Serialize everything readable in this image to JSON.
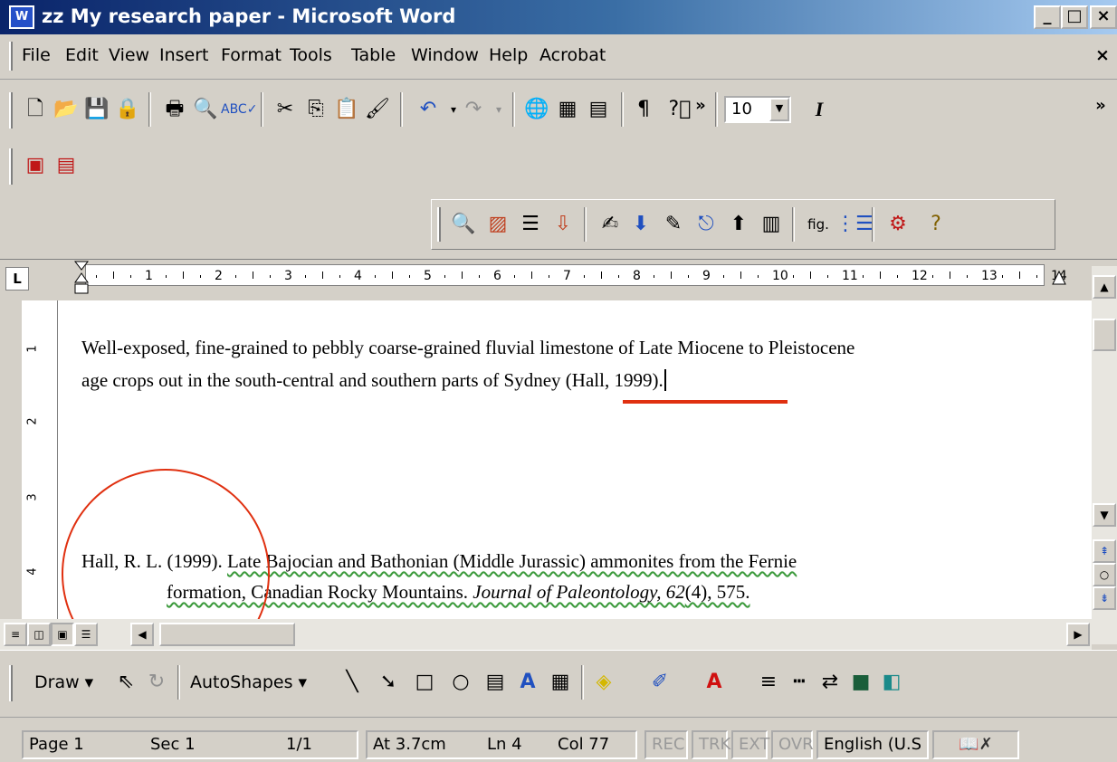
{
  "window": {
    "title": "zz My research paper - Microsoft Word",
    "app_icon": "W",
    "minimize_glyph": "_",
    "maximize_glyph": "□",
    "close_glyph": "×",
    "menu_close_glyph": "×"
  },
  "menu": [
    "File",
    "Edit",
    "View",
    "Insert",
    "Format",
    "Tools",
    "Table",
    "Window",
    "Help",
    "Acrobat"
  ],
  "standard_toolbar": {
    "icons": [
      "new-document-icon",
      "open-folder-icon",
      "save-icon",
      "permission-icon",
      "print-icon",
      "print-preview-icon",
      "spelling-icon",
      "cut-icon",
      "copy-icon",
      "paste-icon",
      "format-painter-icon",
      "undo-icon",
      "redo-icon",
      "hyperlink-icon",
      "tables-borders-icon",
      "insert-table-icon",
      "show-formatting-icon",
      "help-icon"
    ],
    "font_size": "10",
    "italic": "I",
    "overflow": "»"
  },
  "ruler": {
    "tab_selector": "L",
    "ticks": [
      "1",
      "2",
      "3",
      "4",
      "5",
      "6",
      "7",
      "8",
      "9",
      "10",
      "11",
      "12",
      "13",
      "14"
    ]
  },
  "vertical_ruler": [
    "1",
    "2",
    "3",
    "4"
  ],
  "document": {
    "paragraph_line1": "Well-exposed, fine-grained to pebbly coarse-grained fluvial limestone of Late Miocene to Pleistocene",
    "paragraph_line2_pre": "age crops out in the south-central and southern parts of ",
    "paragraph_line2_cite": "Sydney (Hall, 1999).",
    "ref_author": "Hall, R. L. (1999). ",
    "ref_title1": "Late Bajocian and Bathonian (Middle Jurassic) ammonites from the Fernie",
    "ref_title2": "formation, Canadian Rocky Mountains. ",
    "ref_journal": "Journal of Paleontology, 62",
    "ref_issue": "(4), 575."
  },
  "annotation_colors": {
    "underline": "#e03010",
    "circle": "#e03010"
  },
  "draw_toolbar": {
    "draw": "Draw",
    "autoshapes": "AutoShapes"
  },
  "status": {
    "page": "Page 1",
    "sec": "Sec 1",
    "pages": "1/1",
    "at": "At 3.7cm",
    "ln": "Ln 4",
    "col": "Col 77",
    "rec": "REC",
    "trk": "TRK",
    "ext": "EXT",
    "ovr": "OVR",
    "lang": "English (U.S"
  }
}
